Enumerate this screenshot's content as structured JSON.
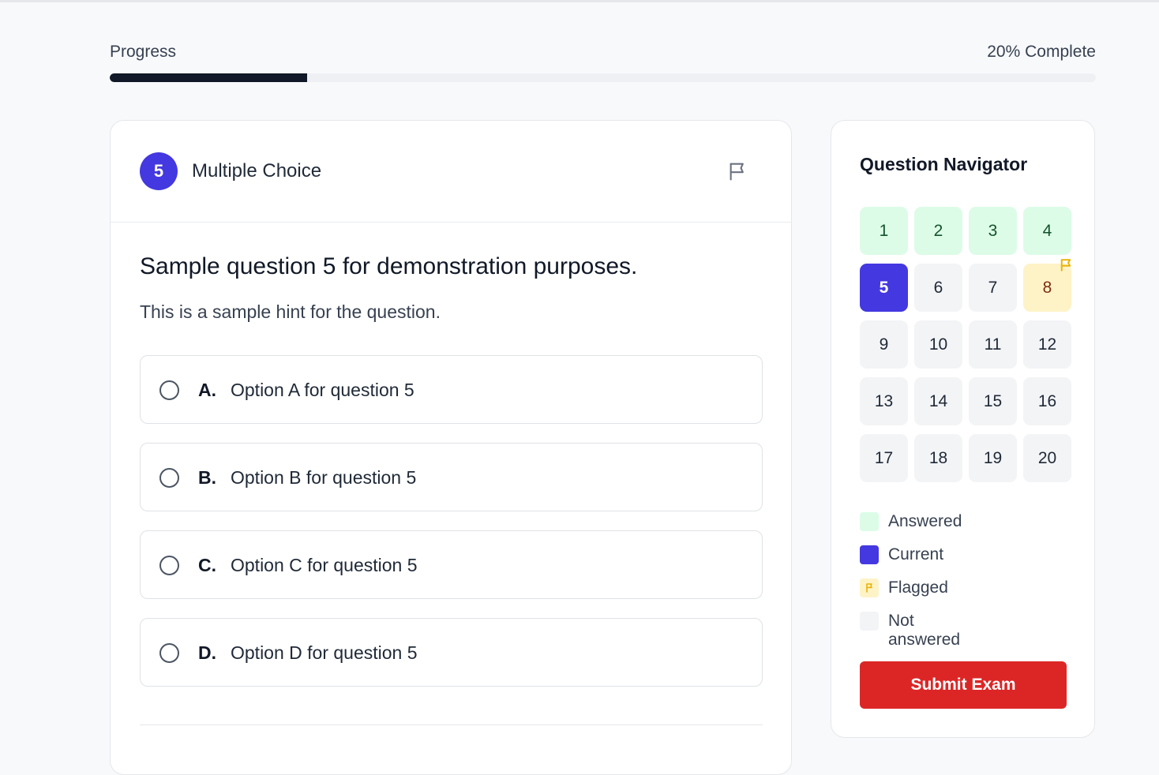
{
  "progress": {
    "label": "Progress",
    "complete_text": "20% Complete",
    "fraction": 0.2
  },
  "question": {
    "number": "5",
    "type": "Multiple Choice",
    "text": "Sample question 5 for demonstration purposes.",
    "hint": "This is a sample hint for the question.",
    "options": [
      {
        "letter": "A.",
        "text": "Option A for question 5"
      },
      {
        "letter": "B.",
        "text": "Option B for question 5"
      },
      {
        "letter": "C.",
        "text": "Option C for question 5"
      },
      {
        "letter": "D.",
        "text": "Option D for question 5"
      }
    ]
  },
  "navigator": {
    "title": "Question Navigator",
    "questions": [
      {
        "label": "1",
        "status": "answered"
      },
      {
        "label": "2",
        "status": "answered"
      },
      {
        "label": "3",
        "status": "answered"
      },
      {
        "label": "4",
        "status": "answered"
      },
      {
        "label": "5",
        "status": "current"
      },
      {
        "label": "6",
        "status": "unanswered"
      },
      {
        "label": "7",
        "status": "unanswered"
      },
      {
        "label": "8",
        "status": "flagged"
      },
      {
        "label": "9",
        "status": "unanswered"
      },
      {
        "label": "10",
        "status": "unanswered"
      },
      {
        "label": "11",
        "status": "unanswered"
      },
      {
        "label": "12",
        "status": "unanswered"
      },
      {
        "label": "13",
        "status": "unanswered"
      },
      {
        "label": "14",
        "status": "unanswered"
      },
      {
        "label": "15",
        "status": "unanswered"
      },
      {
        "label": "16",
        "status": "unanswered"
      },
      {
        "label": "17",
        "status": "unanswered"
      },
      {
        "label": "18",
        "status": "unanswered"
      },
      {
        "label": "19",
        "status": "unanswered"
      },
      {
        "label": "20",
        "status": "unanswered"
      }
    ],
    "legend": {
      "answered": "Answered",
      "current": "Current",
      "flagged": "Flagged",
      "not_answered": "Not answered"
    },
    "submit_label": "Submit Exam"
  },
  "colors": {
    "accent": "#4438e0",
    "answered_bg": "#dcfce7",
    "flagged_bg": "#fef3c7",
    "flag_icon": "#eab308",
    "unanswered_bg": "#f3f4f6",
    "submit": "#dc2626",
    "progress_fill": "#111827"
  },
  "icons": {
    "flag": "flag-icon",
    "radio": "radio-icon"
  }
}
